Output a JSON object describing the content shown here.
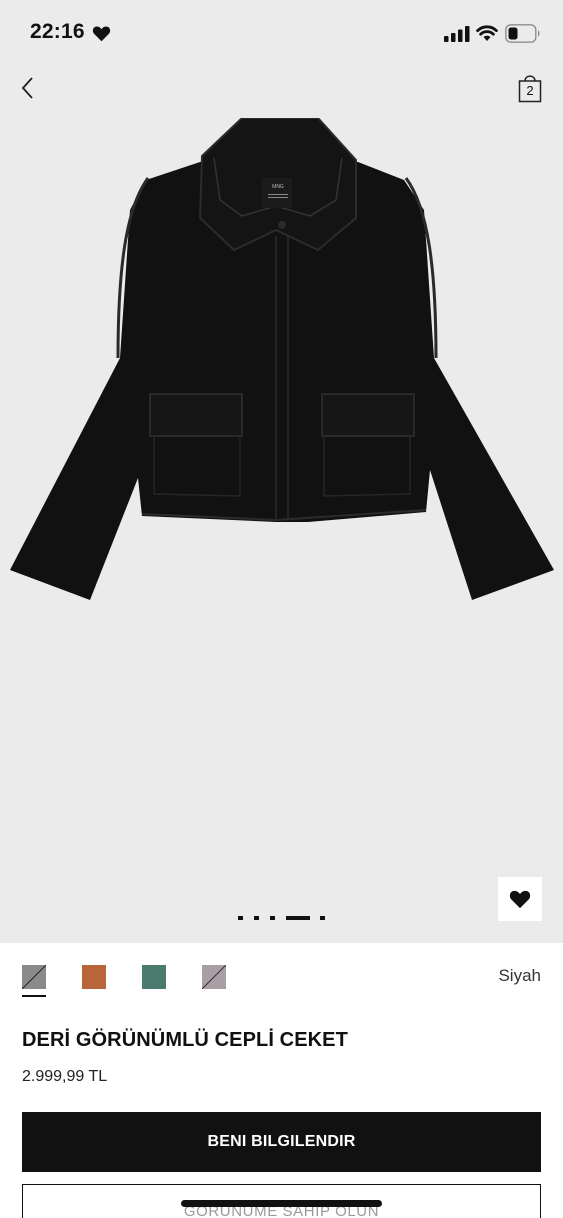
{
  "status_bar": {
    "time": "22:16"
  },
  "nav": {
    "bag_count": "2"
  },
  "product_image": {
    "logo_text": "MNG"
  },
  "carousel": {
    "slide_count": 5,
    "active_index": 3
  },
  "colors": {
    "swatches": [
      {
        "name": "gray",
        "hex": "#8a8a8a",
        "crossed": true,
        "selected": true
      },
      {
        "name": "brown",
        "hex": "#b8653a",
        "crossed": false,
        "selected": false
      },
      {
        "name": "green",
        "hex": "#4b7b6e",
        "crossed": false,
        "selected": false
      },
      {
        "name": "mauve",
        "hex": "#a99ea4",
        "crossed": true,
        "selected": false
      }
    ],
    "selected_label": "Siyah"
  },
  "product": {
    "title": "DERİ GÖRÜNÜMLÜ CEPLİ CEKET",
    "price": "2.999,99 TL"
  },
  "actions": {
    "notify_label": "BENI BILGILENDIR",
    "secondary_label": "GÖRÜNÜME SAHİP OLUN"
  },
  "icons": {
    "time_heart": "heart-icon",
    "signal": "cellular-signal-icon",
    "wifi": "wifi-icon",
    "battery": "battery-icon",
    "back": "chevron-left-icon",
    "bag": "shopping-bag-icon",
    "favorite": "heart-icon"
  }
}
